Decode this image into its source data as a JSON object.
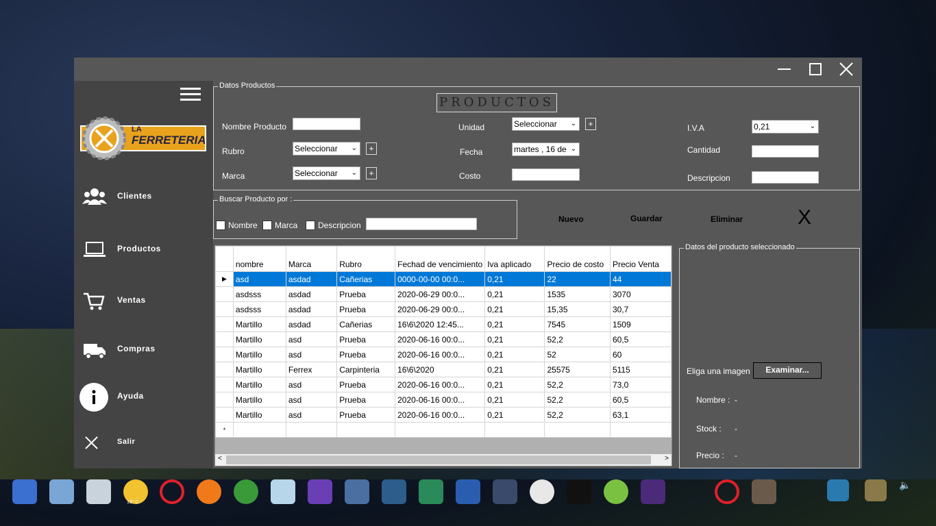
{
  "window": {
    "minimize": "—",
    "maximize": "☐",
    "close": "✕"
  },
  "sidebar": {
    "logo_line1": "LA",
    "logo_line2": "FERRETERIA",
    "items": [
      {
        "label": "Clientes",
        "icon": "users-icon"
      },
      {
        "label": "Productos",
        "icon": "laptop-icon"
      },
      {
        "label": "Ventas",
        "icon": "cart-icon"
      },
      {
        "label": "Compras",
        "icon": "truck-icon"
      },
      {
        "label": "Ayuda",
        "icon": "info-icon"
      },
      {
        "label": "Salir",
        "icon": "close-icon"
      }
    ]
  },
  "form": {
    "group_title": "Datos Productos",
    "title": "PRODUCTOS",
    "nombre_label": "Nombre Producto",
    "rubro_label": "Rubro",
    "rubro_value": "Seleccionar",
    "marca_label": "Marca",
    "marca_value": "Seleccionar",
    "unidad_label": "Unidad",
    "unidad_value": "Seleccionar",
    "fecha_label": "Fecha",
    "fecha_value": "martes  , 16 de",
    "costo_label": "Costo",
    "iva_label": "I.V.A",
    "iva_value": "0,21",
    "cantidad_label": "Cantidad",
    "descripcion_label": "Descripcion",
    "plus": "+"
  },
  "search": {
    "group_title": "Buscar Producto por :",
    "opt_nombre": "Nombre",
    "opt_marca": "Marca",
    "opt_descripcion": "Descripcion"
  },
  "actions": {
    "nuevo": "Nuevo",
    "guardar": "Guardar",
    "eliminar": "Eliminar",
    "close": "X"
  },
  "grid": {
    "columns": [
      "nombre",
      "Marca",
      "Rubro",
      "Fechad de vencimiento",
      "Iva aplicado",
      "Precio de costo",
      "Precio Venta"
    ],
    "rows": [
      [
        "asd",
        "asdad",
        "Cañerias",
        "0000-00-00 00:0...",
        "0,21",
        "22",
        "44"
      ],
      [
        "asdsss",
        "asdad",
        "Prueba",
        "2020-06-29 00:0...",
        "0,21",
        "1535",
        "3070"
      ],
      [
        "asdsss",
        "asdad",
        "Prueba",
        "2020-06-29 00:0...",
        "0,21",
        "15,35",
        "30,7"
      ],
      [
        "Martillo",
        "asdad",
        "Cañerias",
        "16\\6\\2020 12:45...",
        "0,21",
        "7545",
        "1509"
      ],
      [
        "Martillo",
        "asd",
        "Prueba",
        "2020-06-16 00:0...",
        "0,21",
        "52,2",
        "60,5"
      ],
      [
        "Martillo",
        "asd",
        "Prueba",
        "2020-06-16 00:0...",
        "0,21",
        "52",
        "60"
      ],
      [
        "Martillo",
        "Ferrex",
        "Carpinteria",
        "16\\6\\2020",
        "0,21",
        "25575",
        "5115"
      ],
      [
        "Martillo",
        "asd",
        "Prueba",
        "2020-06-16 00:0...",
        "0,21",
        "52,2",
        "73,0"
      ],
      [
        "Martillo",
        "asd",
        "Prueba",
        "2020-06-16 00:0...",
        "0,21",
        "52,2",
        "60,5"
      ],
      [
        "Martillo",
        "asd",
        "Prueba",
        "2020-06-16 00:0...",
        "0,21",
        "52,2",
        "63,1"
      ]
    ],
    "new_row_marker": "*",
    "selected_marker": "▶"
  },
  "details": {
    "group_title": "Datos del producto seleccionado",
    "imagen_label": "Eliga una imagen",
    "examinar": "Examinar...",
    "nombre": "Nombre :",
    "nombre_value": "-",
    "stock": "Stock :",
    "stock_value": "-",
    "precio": "Precio :",
    "precio_value": "-"
  },
  "taskbar": {
    "weather_temp": "13° C"
  }
}
